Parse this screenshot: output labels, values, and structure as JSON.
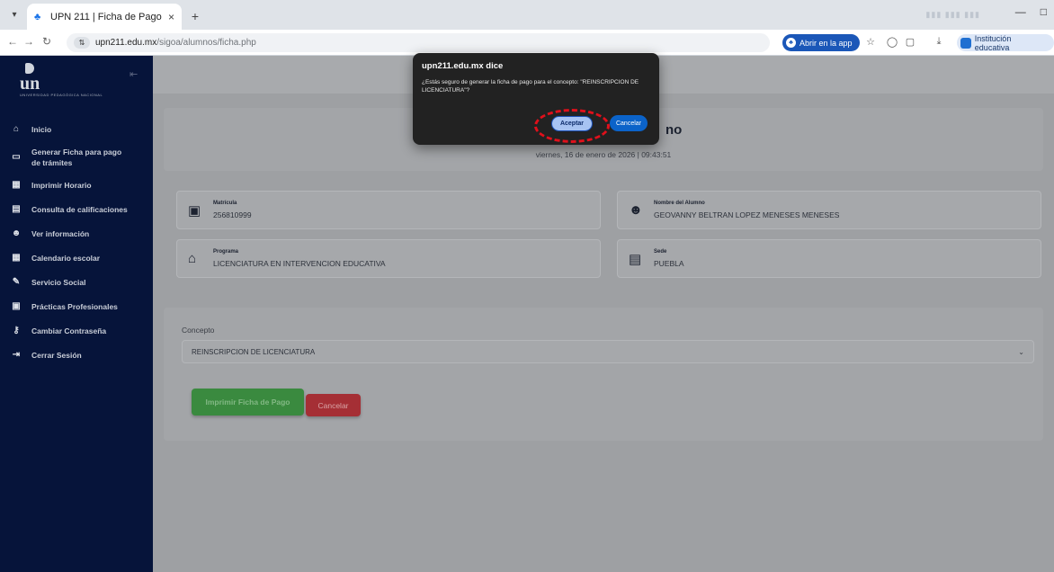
{
  "browser": {
    "tab_title": "UPN 211 | Ficha de Pago",
    "tab_close": "×",
    "new_tab": "+",
    "url_domain": "upn211.edu.mx",
    "url_path": "/sigoa/alumnos/ficha.php",
    "open_in_app": "Abrir en la app",
    "profile_label": "Institución educativa",
    "minimize": "—",
    "restore": "□"
  },
  "sidebar": {
    "logo_text": "un",
    "logo_subtext": "UNIVERSIDAD PEDAGÓGICA NACIONAL",
    "items": [
      {
        "label": "Inicio",
        "icon": "home-icon"
      },
      {
        "label": "Generar Ficha para pago de trámites",
        "icon": "card-icon"
      },
      {
        "label": "Imprimir Horario",
        "icon": "calendar-icon"
      },
      {
        "label": "Consulta de calificaciones",
        "icon": "file-icon"
      },
      {
        "label": "Ver información",
        "icon": "user-icon"
      },
      {
        "label": "Calendario escolar",
        "icon": "calendar-icon"
      },
      {
        "label": "Servicio Social",
        "icon": "feather-icon"
      },
      {
        "label": "Prácticas Profesionales",
        "icon": "briefcase-icon"
      },
      {
        "label": "Cambiar Contraseña",
        "icon": "key-icon"
      },
      {
        "label": "Cerrar Sesión",
        "icon": "logout-icon"
      }
    ]
  },
  "main": {
    "heading_fragment": "no",
    "datetime": "viernes, 16 de enero de 2026 | 09:43:51",
    "matricula_label": "Matrícula",
    "matricula_value": "256810999",
    "nombre_label": "Nombre del Alumno",
    "nombre_value": "GEOVANNY BELTRAN LOPEZ MENESES MENESES",
    "programa_label": "Programa",
    "programa_value": "LICENCIATURA EN INTERVENCION EDUCATIVA",
    "sede_label": "Sede",
    "sede_value": "PUEBLA",
    "concepto_label": "Concepto",
    "concepto_value": "REINSCRIPCION DE LICENCIATURA",
    "print_button": "Imprimir Ficha de Pago",
    "cancel_button": "Cancelar"
  },
  "dialog": {
    "title": "upn211.edu.mx dice",
    "message": "¿Estás seguro de generar la ficha de pago para el concepto: \"REINSCRIPCION DE LICENCIATURA\"?",
    "accept": "Aceptar",
    "cancel": "Cancelar"
  },
  "colors": {
    "sidebar_bg": "#06143a",
    "accent_blue": "#0b63c9",
    "print_green": "#3a8a3f",
    "cancel_red": "#a52f35",
    "highlight": "#e0101b"
  }
}
